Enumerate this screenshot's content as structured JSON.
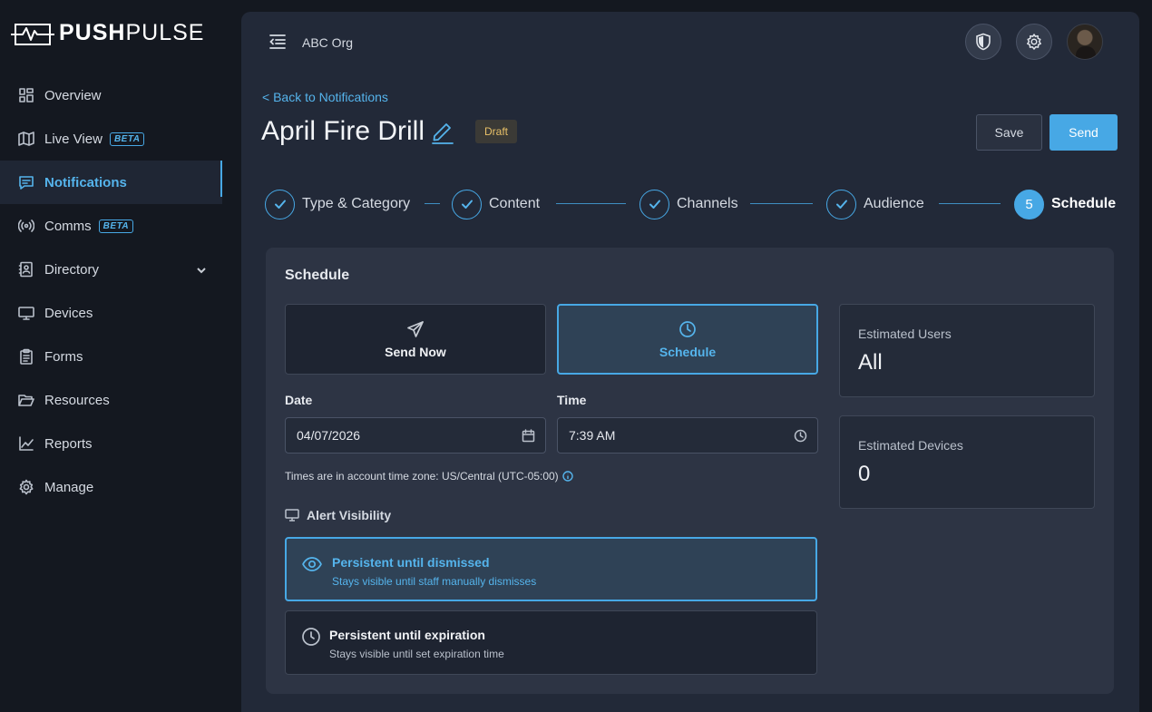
{
  "brand": {
    "name_bold": "PUSH",
    "name_regular": "PULSE"
  },
  "sidebar": {
    "items": [
      {
        "label": "Overview",
        "icon": "dashboard-icon"
      },
      {
        "label": "Live View",
        "icon": "map-icon",
        "badge": "BETA"
      },
      {
        "label": "Notifications",
        "icon": "message-icon",
        "active": true
      },
      {
        "label": "Comms",
        "icon": "broadcast-icon",
        "badge": "BETA"
      },
      {
        "label": "Directory",
        "icon": "contact-book-icon",
        "expandable": true
      },
      {
        "label": "Devices",
        "icon": "monitor-icon"
      },
      {
        "label": "Forms",
        "icon": "clipboard-icon"
      },
      {
        "label": "Resources",
        "icon": "folder-open-icon"
      },
      {
        "label": "Reports",
        "icon": "line-chart-icon"
      },
      {
        "label": "Manage",
        "icon": "gear-icon"
      }
    ]
  },
  "header": {
    "org_name": "ABC Org"
  },
  "page": {
    "back_link": "< Back to Notifications",
    "title": "April Fire Drill",
    "status_badge": "Draft",
    "save_label": "Save",
    "send_label": "Send"
  },
  "stepper": {
    "steps": [
      {
        "label": "Type & Category",
        "done": true
      },
      {
        "label": "Content",
        "done": true
      },
      {
        "label": "Channels",
        "done": true
      },
      {
        "label": "Audience",
        "done": true
      },
      {
        "label": "Schedule",
        "number": "5",
        "current": true
      }
    ]
  },
  "schedule": {
    "title": "Schedule",
    "options": {
      "send_now": "Send Now",
      "schedule": "Schedule",
      "selected": "schedule"
    },
    "date_label": "Date",
    "date_value": "04/07/2026",
    "time_label": "Time",
    "time_value": "7:39 AM",
    "timezone_note": "Times are in account time zone: US/Central (UTC-05:00)",
    "visibility": {
      "heading": "Alert Visibility",
      "options": [
        {
          "title": "Persistent until dismissed",
          "subtitle": "Stays visible until staff manually dismisses",
          "selected": true
        },
        {
          "title": "Persistent until expiration",
          "subtitle": "Stays visible until set expiration time",
          "selected": false
        }
      ]
    },
    "estimates": {
      "users_label": "Estimated Users",
      "users_value": "All",
      "devices_label": "Estimated Devices",
      "devices_value": "0"
    }
  },
  "colors": {
    "accent": "#47a8e5",
    "draft": "#e8c068",
    "background": "#141820",
    "panel": "#222938"
  }
}
